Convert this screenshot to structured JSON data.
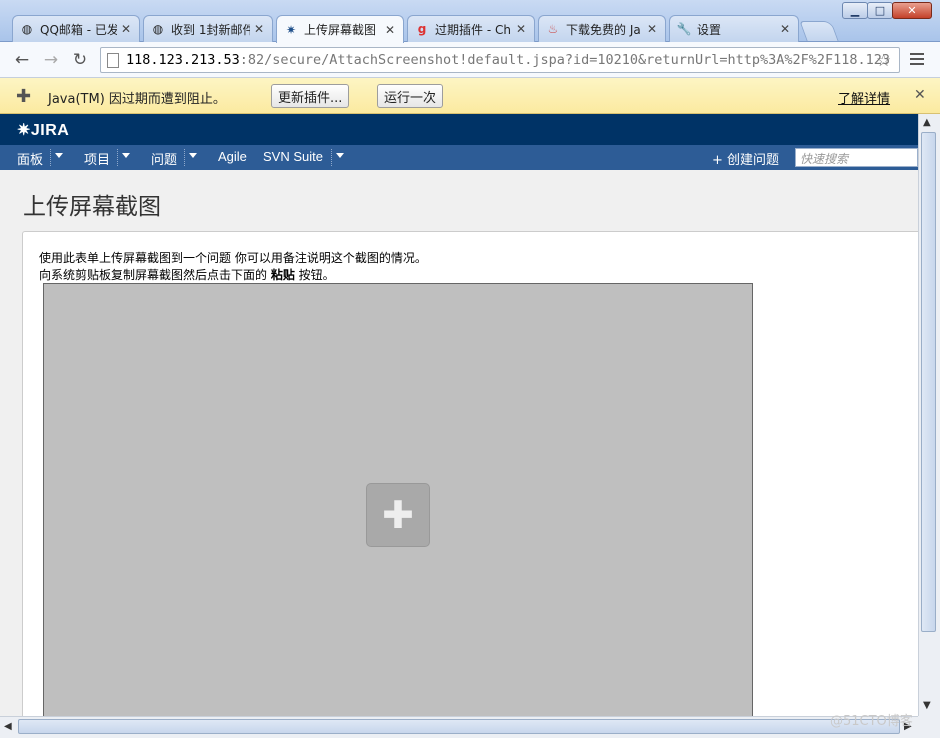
{
  "window": {
    "minimize_glyph": "▁",
    "maximize_glyph": "□",
    "close_glyph": "✕"
  },
  "tabs": [
    {
      "label": "QQ邮箱 - 已发",
      "icon": "qq-mail-icon",
      "close": "✕"
    },
    {
      "label": "收到 1封新邮件",
      "icon": "qq-mail-icon",
      "close": "✕"
    },
    {
      "label": "上传屏幕截图",
      "icon": "jira-icon",
      "close": "✕"
    },
    {
      "label": "过期插件 - Ch",
      "icon": "google-icon",
      "close": "✕"
    },
    {
      "label": "下载免费的 Ja",
      "icon": "java-icon",
      "close": "✕"
    },
    {
      "label": "设置",
      "icon": "wrench-icon",
      "close": "✕"
    }
  ],
  "toolbar": {
    "back": "←",
    "forward": "→",
    "reload": "↻",
    "url_host": "118.123.213.53",
    "url_path": ":82/secure/AttachScreenshot!default.jspa?id=10210&returnUrl=http%3A%2F%2F118.123",
    "star": "☆"
  },
  "infobar": {
    "message": "Java(TM) 因过期而遭到阻止。",
    "update_label": "更新插件...",
    "run_once_label": "运行一次",
    "learn_more": "了解详情",
    "close": "✕"
  },
  "jira": {
    "logo_text": "JIRA",
    "nav": {
      "dashboards": "面板",
      "projects": "项目",
      "issues": "问题",
      "agile": "Agile",
      "svn": "SVN Suite",
      "create": "创建问题",
      "create_plus": "+",
      "search_placeholder": "快速搜索"
    }
  },
  "page": {
    "title": "上传屏幕截图",
    "desc_line1": "使用此表单上传屏幕截图到一个问题 你可以用备注说明这个截图的情况。",
    "desc_line2_pre": "向系统剪贴板复制屏幕截图然后点击下面的 ",
    "desc_line2_bold": "粘贴",
    "desc_line2_post": " 按钮。"
  },
  "watermark": "@51CTO博客"
}
